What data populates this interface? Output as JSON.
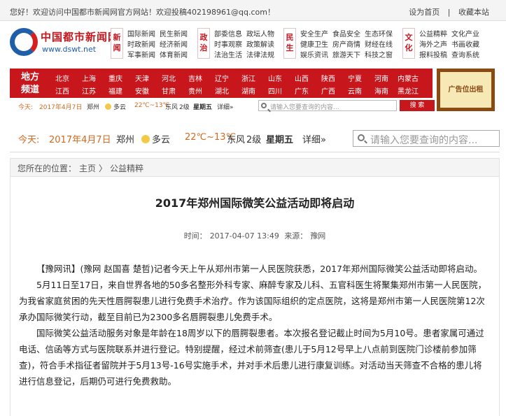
{
  "topbar": {
    "welcome": "您好！欢迎访问中国都市新闻网官方网站！欢迎投稿402198961@qq.com！",
    "set_home": "设为首页",
    "favorite": "收藏本站"
  },
  "logo": {
    "name": "中国都市新闻网",
    "url": "www.dswt.net"
  },
  "nav_groups": [
    {
      "tag": "新闻",
      "col1": [
        "国际新闻",
        "时政新闻",
        "军事新闻"
      ],
      "col2": [
        "民生新闻",
        "经济新闻",
        "体育新闻"
      ]
    },
    {
      "tag": "政治",
      "col1": [
        "部委信息",
        "时事观察",
        "法治生活"
      ],
      "col2": [
        "政坛人物",
        "政策解读",
        "法律法规"
      ]
    },
    {
      "tag": "民生",
      "col1": [
        "安全生产",
        "健康卫生",
        "娱乐资讯"
      ],
      "col2": [
        "食品安全",
        "房产商情",
        "旅游天下"
      ],
      "col3": [
        "生态环保",
        "财经在线",
        "科技之窗"
      ]
    },
    {
      "tag": "文化",
      "col1": [
        "公益精粹",
        "海外之声",
        "报料投稿"
      ],
      "col2": [
        "文化产业",
        "书画收藏",
        "查询系统"
      ]
    }
  ],
  "local": {
    "title_line1": "地方",
    "title_line2": "频道",
    "row1": [
      "北京",
      "上海",
      "重庆",
      "天津",
      "河北",
      "吉林",
      "辽宁",
      "浙江",
      "山东",
      "山西",
      "陕西",
      "宁夏",
      "河南",
      "内蒙古"
    ],
    "row2": [
      "江西",
      "江苏",
      "福建",
      "安徽",
      "甘肃",
      "贵州",
      "湖北",
      "湖南",
      "四川",
      "广东",
      "广西",
      "云南",
      "海南",
      "黑龙江"
    ]
  },
  "ad_label": "广告位出租",
  "weather": {
    "today_label": "今天:",
    "date": "2017年4月7日",
    "city": "郑州",
    "condition": "多云",
    "temp": "22℃~13℃",
    "wind": "东风",
    "wind_level": "2级",
    "weekday": "星期五",
    "detail": "详细»"
  },
  "search": {
    "placeholder": "请输入您要查询的内容...",
    "button": "搜 索"
  },
  "breadcrumb": [
    "您所在的位置：",
    "主页",
    "〉",
    "公益精粹"
  ],
  "article": {
    "title": "2017年郑州国际微笑公益活动即将启动",
    "time_label": "时间：",
    "time": "2017-04-07 13:49",
    "source_label": "来源：",
    "source": "豫网",
    "paragraphs": [
      "【豫网讯】(豫网 赵国喜 楚哲)记者今天上午从郑州市第一人民医院获悉，2017年郑州国际微笑公益活动即将启动。",
      "5月11日至17日，来自世界各地的50多名整形外科专家、麻醉专家及儿科、五官科医生将聚集郑州市第一人民医院，为我省家庭贫困的先天性唇腭裂患儿进行免费手术治疗。作为该国际组织的定点医院，这将是郑州市第一人民医院第12次承办国际微笑行动，截至目前已为2300多名唇腭裂患儿免费手术。",
      "国际微笑公益活动服务对象是年龄在18周岁以下的唇腭裂患者。本次报名登记截止时间为5月10号。患者家属可通过电话、信函等方式与医院联系并进行登记。特别提醒，经过术前筛查(患儿于5月12号早上八点前到医院门诊楼前参加筛查)，符合手术指征者留院并于5月13号-16号实施手术，并对手术后患儿进行康复训练。对活动当天筛查不合格的患儿将进行信息登记，后期仍可进行免费救助。"
    ]
  },
  "colors": {
    "brand_red": "#c8161d",
    "brand_blue": "#1f5ea8",
    "date_orange": "#d2691e"
  }
}
